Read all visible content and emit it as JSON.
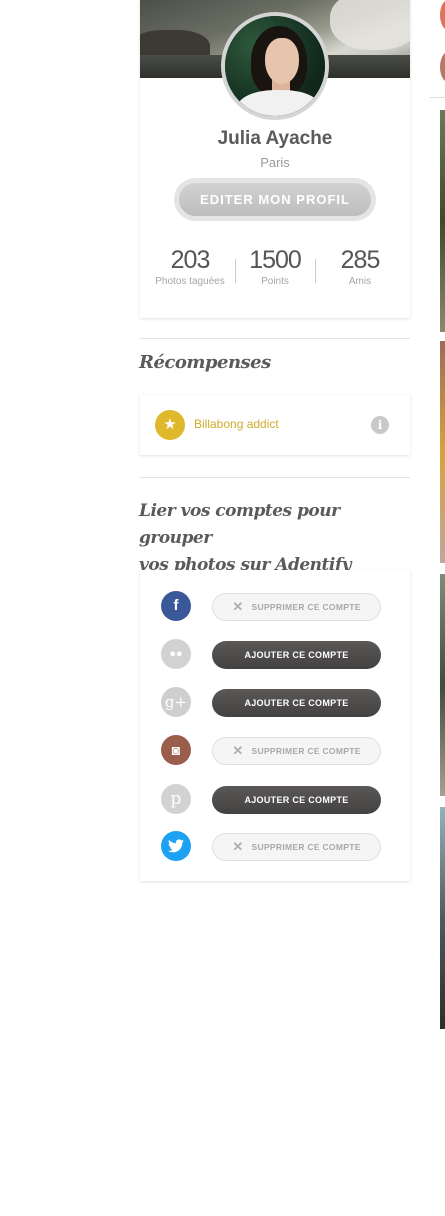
{
  "profile": {
    "name": "Julia Ayache",
    "city": "Paris",
    "edit_button": "EDITER MON PROFIL",
    "stats": [
      {
        "value": "203",
        "label": "Photos taguées"
      },
      {
        "value": "1500",
        "label": "Points"
      },
      {
        "value": "285",
        "label": "Amis"
      }
    ]
  },
  "rewards": {
    "title": "Récompenses",
    "items": [
      {
        "label": "Billabong addict",
        "icon": "star-icon",
        "info_icon": "info-icon"
      }
    ]
  },
  "link_accounts": {
    "title_line1": "Lier vos comptes pour grouper",
    "title_line2": "vos photos sur Adentify",
    "accounts": [
      {
        "service": "facebook",
        "icon_glyph": "f",
        "color": "#3b5998",
        "action": "remove",
        "button_label": "SUPPRIMER CE COMPTE"
      },
      {
        "service": "flickr",
        "icon_glyph": "●●",
        "color": "#d2d2d2",
        "action": "add",
        "button_label": "AJOUTER CE COMPTE"
      },
      {
        "service": "google-plus",
        "icon_glyph": "g+",
        "color": "#cfcfcf",
        "action": "add",
        "button_label": "AJOUTER CE COMPTE"
      },
      {
        "service": "instagram",
        "icon_glyph": "◙",
        "color": "#9b5d4b",
        "action": "remove",
        "button_label": "SUPPRIMER CE COMPTE"
      },
      {
        "service": "pinterest",
        "icon_glyph": "p",
        "color": "#d2d2d2",
        "action": "add",
        "button_label": "AJOUTER CE COMPTE"
      },
      {
        "service": "twitter",
        "icon_glyph": "🐦",
        "color": "#1da1f2",
        "action": "remove",
        "button_label": "SUPPRIMER CE COMPTE"
      }
    ],
    "remove_icon": "close-icon"
  },
  "colors": {
    "accent_gold": "#d1ab2a",
    "button_dark": "#4d4a4a",
    "text_dark": "#555555"
  }
}
